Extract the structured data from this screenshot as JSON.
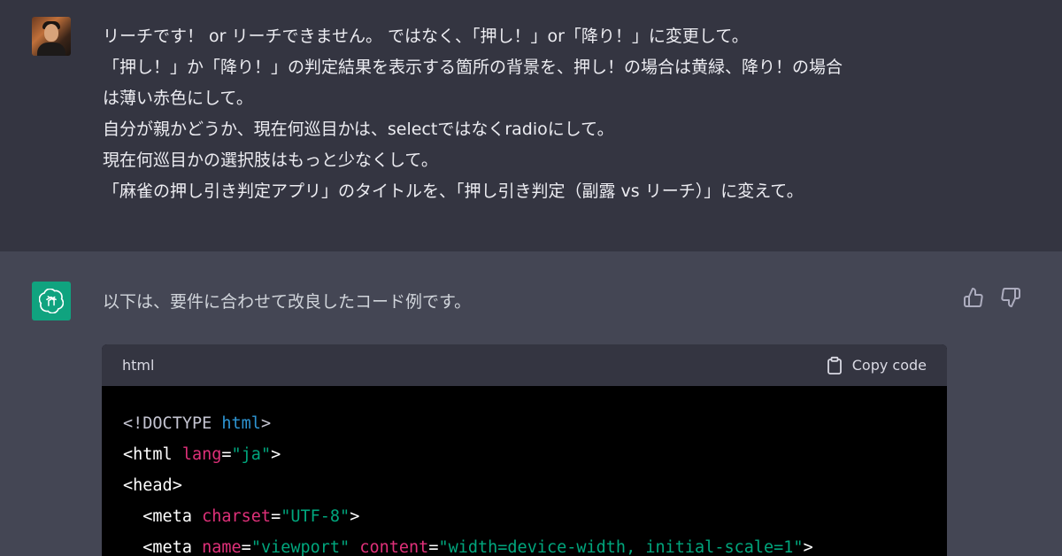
{
  "user_message": {
    "lines": [
      "リーチです！ or リーチできません。 ではなく、「押し！」or「降り！」に変更して。",
      "「押し！」か「降り！」の判定結果を表示する箇所の背景を、押し！の場合は黄緑、降り！の場合",
      "は薄い赤色にして。",
      "自分が親かどうか、現在何巡目かは、selectではなくradioにして。",
      "現在何巡目かの選択肢はもっと少なくして。",
      "「麻雀の押し引き判定アプリ」のタイトルを、「押し引き判定（副露 vs リーチ）」に変えて。"
    ]
  },
  "assistant_message": {
    "intro": "以下は、要件に合わせて改良したコード例です。",
    "code_block": {
      "language": "html",
      "copy_label": "Copy code",
      "lines": [
        [
          {
            "t": "<!DOCTYPE ",
            "c": "doc"
          },
          {
            "t": "html",
            "c": "kw"
          },
          {
            "t": ">",
            "c": "doc"
          }
        ],
        [
          {
            "t": "<html ",
            "c": "plain"
          },
          {
            "t": "lang",
            "c": "attr"
          },
          {
            "t": "=",
            "c": "plain"
          },
          {
            "t": "\"ja\"",
            "c": "str"
          },
          {
            "t": ">",
            "c": "plain"
          }
        ],
        [
          {
            "t": "<head>",
            "c": "plain"
          }
        ],
        [
          {
            "t": "  <meta ",
            "c": "plain"
          },
          {
            "t": "charset",
            "c": "attr"
          },
          {
            "t": "=",
            "c": "plain"
          },
          {
            "t": "\"UTF-8\"",
            "c": "str"
          },
          {
            "t": ">",
            "c": "plain"
          }
        ],
        [
          {
            "t": "  <meta ",
            "c": "plain"
          },
          {
            "t": "name",
            "c": "attr"
          },
          {
            "t": "=",
            "c": "plain"
          },
          {
            "t": "\"viewport\"",
            "c": "str"
          },
          {
            "t": " ",
            "c": "plain"
          },
          {
            "t": "content",
            "c": "attr"
          },
          {
            "t": "=",
            "c": "plain"
          },
          {
            "t": "\"width=device-width, initial-scale=1\"",
            "c": "str"
          },
          {
            "t": ">",
            "c": "plain"
          }
        ]
      ]
    }
  },
  "icons": {
    "user_avatar": "user-avatar-photo",
    "assistant_avatar": "openai-logo-icon",
    "thumbs_up": "thumbs-up-icon",
    "thumbs_down": "thumbs-down-icon",
    "clipboard": "clipboard-icon"
  },
  "colors": {
    "user_bg": "#343541",
    "assistant_bg": "#444654",
    "gpt_green": "#10a37f",
    "code_bg": "#000000",
    "code_header_bg": "#343541",
    "syntax_keyword": "#2e95d3",
    "syntax_attr": "#df3079",
    "syntax_string": "#00a67d"
  }
}
